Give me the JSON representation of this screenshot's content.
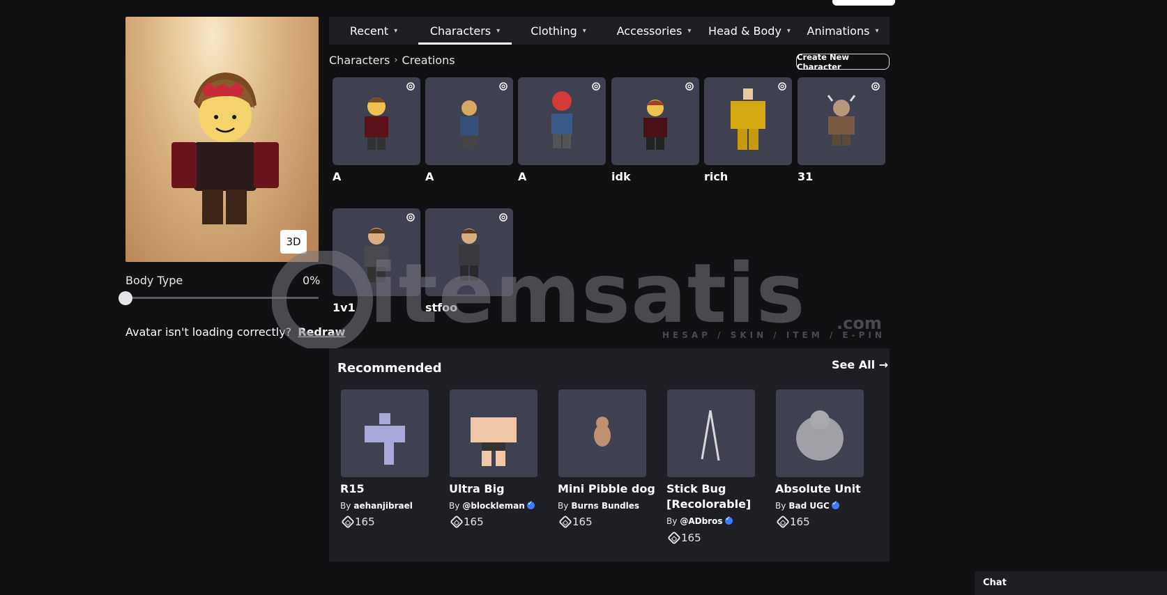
{
  "tabs": [
    {
      "label": "Recent"
    },
    {
      "label": "Characters"
    },
    {
      "label": "Clothing"
    },
    {
      "label": "Accessories"
    },
    {
      "label": "Head & Body"
    },
    {
      "label": "Animations"
    }
  ],
  "avatar": {
    "view_toggle_label": "3D"
  },
  "body_type": {
    "label": "Body Type",
    "value_text": "0%",
    "value": 0
  },
  "redraw": {
    "prompt": "Avatar isn't loading correctly?",
    "link": "Redraw"
  },
  "breadcrumb": {
    "root": "Characters",
    "current": "Creations"
  },
  "create_button": "Create New Character",
  "characters": [
    {
      "name": "A"
    },
    {
      "name": "A"
    },
    {
      "name": "A"
    },
    {
      "name": "idk"
    },
    {
      "name": "rich"
    },
    {
      "name": "31"
    },
    {
      "name": "1v1"
    },
    {
      "name": "stfoo"
    }
  ],
  "watermark": {
    "text": "itemsatis",
    "suffix": ".com",
    "tagline": "HESAP / SKIN / ITEM / E-PIN"
  },
  "recommended": {
    "title": "Recommended",
    "see_all": "See All →",
    "by_prefix": "By",
    "items": [
      {
        "name_line1": "R15",
        "name_line2": "",
        "creator": "aehanjibrael",
        "verified": false,
        "price": "165"
      },
      {
        "name_line1": "Ultra Big",
        "name_line2": "",
        "creator": "@blockleman",
        "verified": true,
        "price": "165"
      },
      {
        "name_line1": "Mini Pibble dog",
        "name_line2": "",
        "creator": "Burns Bundles",
        "verified": false,
        "price": "165"
      },
      {
        "name_line1": "Stick Bug",
        "name_line2": "[Recolorable]",
        "creator": "@ADbros",
        "verified": true,
        "price": "165"
      },
      {
        "name_line1": "Absolute Unit",
        "name_line2": "",
        "creator": "Bad UGC",
        "verified": true,
        "price": "165"
      }
    ]
  },
  "chat": {
    "label": "Chat"
  }
}
